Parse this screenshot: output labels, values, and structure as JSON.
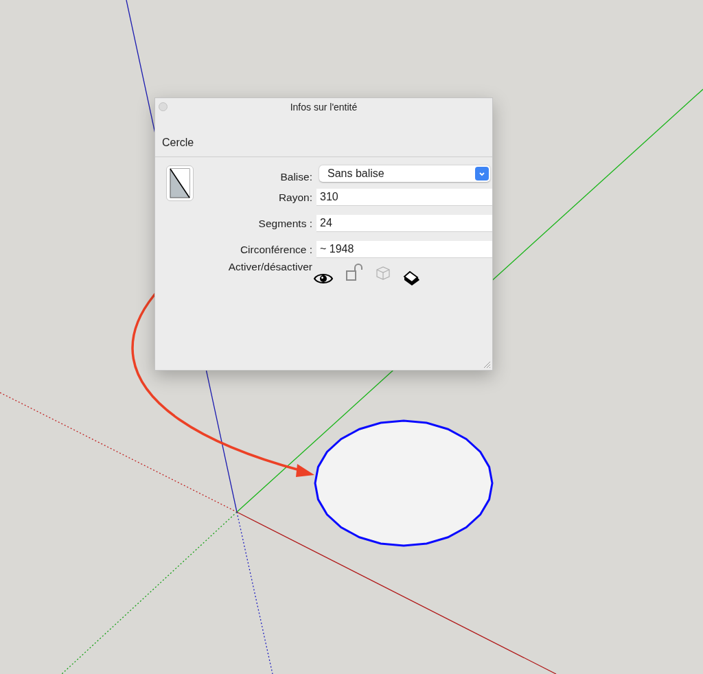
{
  "dialog": {
    "title": "Infos sur l'entité",
    "entity_type": "Cercle",
    "tag": {
      "label": "Balise:",
      "value": "Sans balise"
    },
    "fields": [
      {
        "label": "Rayon:",
        "value": "310"
      },
      {
        "label": "Segments :",
        "value": "24"
      },
      {
        "label": "Circonférence :",
        "value": "~ 1948"
      }
    ],
    "toggle_label": "Activer/désactiver",
    "toggles": [
      {
        "kind": "visibility",
        "on": true
      },
      {
        "kind": "lock",
        "on": false
      },
      {
        "kind": "receive-shadows",
        "on": false
      },
      {
        "kind": "cast-shadows",
        "on": true
      }
    ]
  }
}
